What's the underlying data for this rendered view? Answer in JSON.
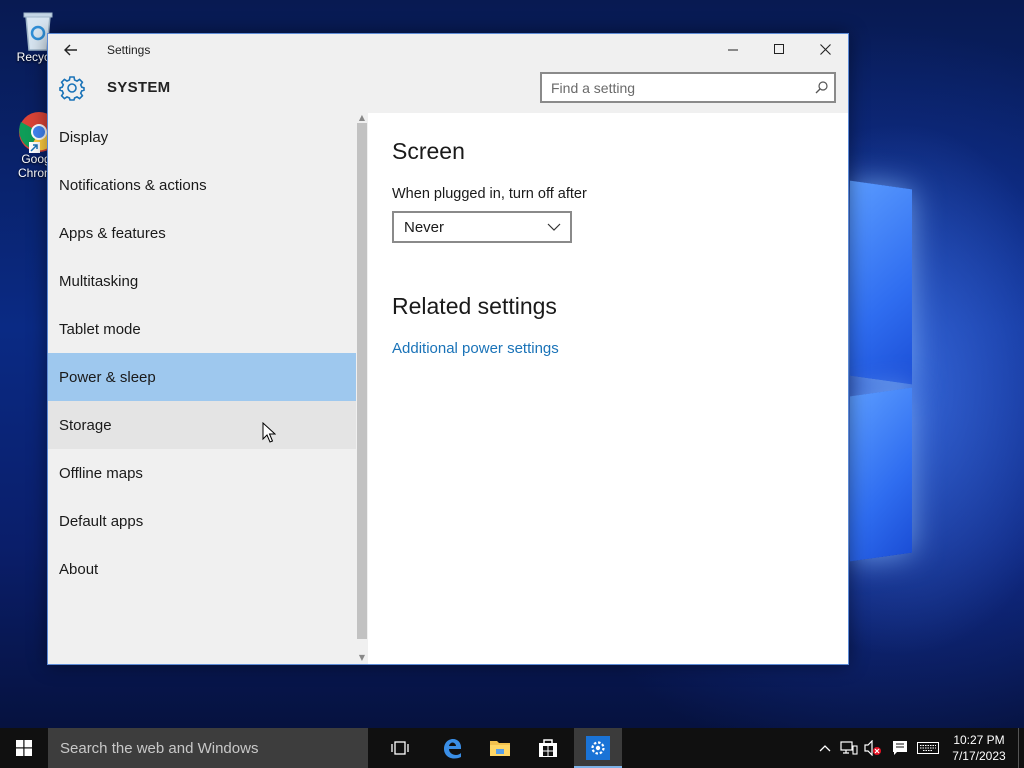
{
  "desktop": {
    "icons": [
      {
        "label": "Recycle"
      },
      {
        "label": "Goog Chrom"
      }
    ]
  },
  "window": {
    "title": "Settings",
    "section_title": "SYSTEM",
    "search": {
      "placeholder": "Find a setting",
      "value": ""
    }
  },
  "sidebar": {
    "items": [
      {
        "label": "Display"
      },
      {
        "label": "Notifications & actions"
      },
      {
        "label": "Apps & features"
      },
      {
        "label": "Multitasking"
      },
      {
        "label": "Tablet mode"
      },
      {
        "label": "Power & sleep"
      },
      {
        "label": "Storage"
      },
      {
        "label": "Offline maps"
      },
      {
        "label": "Default apps"
      },
      {
        "label": "About"
      }
    ],
    "selected_index": 5,
    "hover_index": 6
  },
  "content": {
    "screen_heading": "Screen",
    "plugged_label": "When plugged in, turn off after",
    "plugged_value": "Never",
    "related_heading": "Related settings",
    "related_link": "Additional power settings"
  },
  "taskbar": {
    "search_placeholder": "Search the web and Windows",
    "apps": [
      "task-view",
      "edge",
      "file-explorer",
      "store",
      "settings"
    ],
    "active_app": "settings",
    "time": "10:27 PM",
    "date": "7/17/2023"
  },
  "colors": {
    "accent": "#1a73b8",
    "selected": "#9ec8ee",
    "sidebar_bg": "#f0f0f0",
    "taskbar_bg": "#101010"
  }
}
